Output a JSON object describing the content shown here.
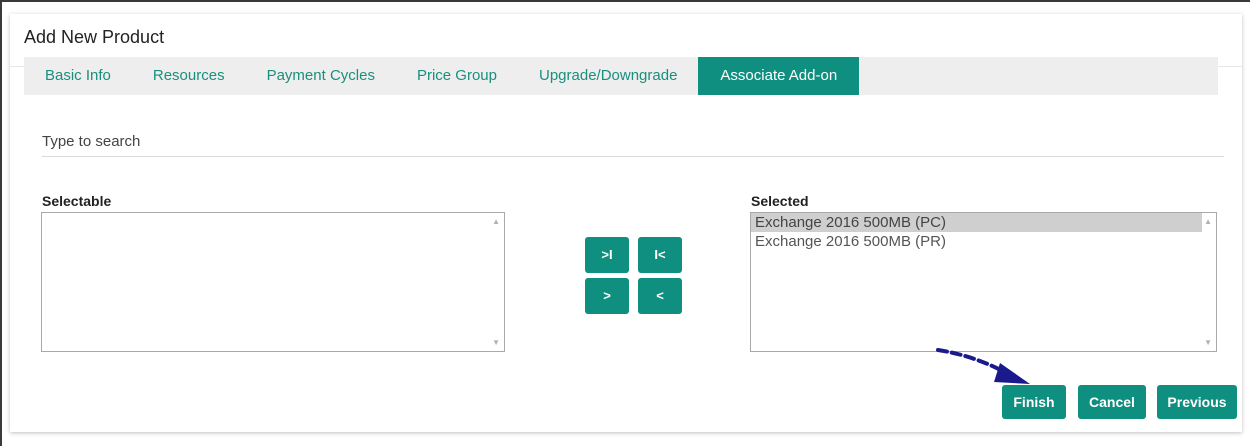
{
  "dialog": {
    "title": "Add New Product"
  },
  "tabs": [
    {
      "label": "Basic Info"
    },
    {
      "label": "Resources"
    },
    {
      "label": "Payment Cycles"
    },
    {
      "label": "Price Group"
    },
    {
      "label": "Upgrade/Downgrade"
    },
    {
      "label": "Associate Add-on",
      "active": true
    }
  ],
  "search": {
    "placeholder": "Type to search",
    "value": ""
  },
  "selectable": {
    "label": "Selectable",
    "items": []
  },
  "selected": {
    "label": "Selected",
    "items": [
      {
        "text": "Exchange 2016 500MB (PC)",
        "highlighted": true
      },
      {
        "text": "Exchange 2016 500MB (PR)",
        "highlighted": false
      }
    ]
  },
  "move_buttons": {
    "move_all_right": ">I",
    "move_all_left": "I<",
    "move_right": ">",
    "move_left": "<"
  },
  "actions": {
    "finish": "Finish",
    "cancel": "Cancel",
    "previous": "Previous"
  },
  "colors": {
    "accent": "#0f8f7f",
    "tab_bar": "#eeeeee",
    "annotation_arrow": "#1a1a8c"
  },
  "icons": {
    "annotation": "dashed-arrow-icon",
    "scroll_up": "scroll-up-icon",
    "scroll_down": "scroll-down-icon"
  }
}
